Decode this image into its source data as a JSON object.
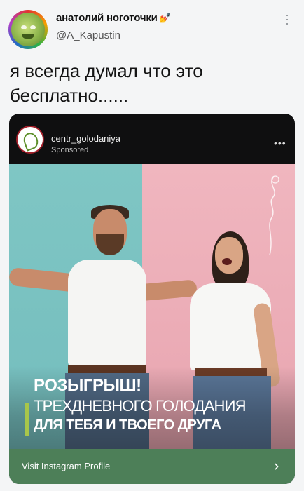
{
  "author": {
    "display_name": "анатолий ноготочки",
    "name_emoji": "💅",
    "handle": "@A_Kapustin"
  },
  "tweet": {
    "text": "я всегда думал что это бесплатно......"
  },
  "ad": {
    "account": "centr_golodaniya",
    "sponsored_label": "Sponsored",
    "more_label": "•••",
    "promo_line1": "РОЗЫГРЫШ!",
    "promo_line2": "ТРЕХДНЕВНОГО ГОЛОДАНИЯ",
    "promo_line3": "ДЛЯ ТЕБЯ И ТВОЕГО ДРУГА",
    "cta_label": "Visit Instagram Profile",
    "cta_icon": "chevron-right-icon"
  },
  "colors": {
    "left_bg": "#7fc6c4",
    "right_bg": "#f0b6bf",
    "cta_bar": "#4d7f58",
    "promo_accent": "#a8c64a"
  }
}
